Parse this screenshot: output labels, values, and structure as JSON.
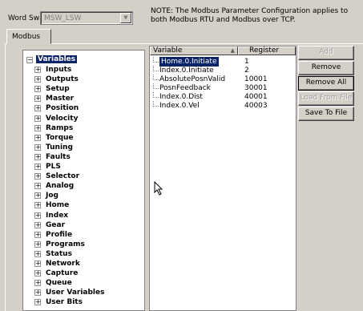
{
  "word_swap": {
    "label": "Word Swap",
    "value": "MSW_LSW"
  },
  "note": "NOTE: The Modbus Parameter Configuration applies to both Modbus RTU and Modbus over TCP.",
  "tabs": [
    {
      "label": "Modbus"
    }
  ],
  "tree": {
    "root": "Variables",
    "children": [
      "Inputs",
      "Outputs",
      "Setup",
      "Master",
      "Position",
      "Velocity",
      "Ramps",
      "Torque",
      "Tuning",
      "Faults",
      "PLS",
      "Selector",
      "Analog",
      "Jog",
      "Home",
      "Index",
      "Gear",
      "Profile",
      "Programs",
      "Status",
      "Network",
      "Capture",
      "Queue",
      "User Variables",
      "User Bits"
    ]
  },
  "list": {
    "headers": {
      "variable": "Variable",
      "register": "Register"
    },
    "rows": [
      {
        "variable": "Home.0.Initiate",
        "register": "1",
        "selected": true
      },
      {
        "variable": "Index.0.Initiate",
        "register": "2"
      },
      {
        "variable": "AbsolutePosnValid",
        "register": "10001"
      },
      {
        "variable": "PosnFeedback",
        "register": "30001"
      },
      {
        "variable": "Index.0.Dist",
        "register": "40001"
      },
      {
        "variable": "Index.0.Vel",
        "register": "40003"
      }
    ]
  },
  "buttons": {
    "add": "Add",
    "remove": "Remove",
    "remove_all": "Remove All",
    "load_from_file": "Load From File",
    "save_to_file": "Save To File"
  },
  "colors": {
    "selection": "#0a246a",
    "face": "#d4d0c8"
  }
}
